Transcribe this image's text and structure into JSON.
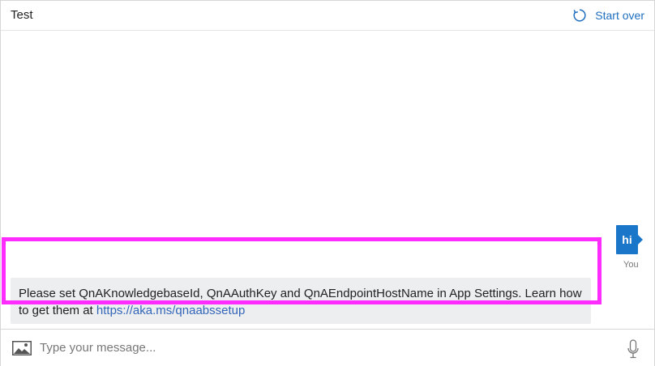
{
  "header": {
    "title": "Test",
    "start_over_label": "Start over",
    "start_over_icon": "refresh-icon"
  },
  "messages": {
    "user": {
      "text": "hi",
      "sender_label": "You"
    },
    "bot": {
      "text_before_link": "Please set QnAKnowledgebaseId, QnAAuthKey and QnAEndpointHostName in App Settings. Learn how to get them at ",
      "link_text": "https://aka.ms/qnaabssetup"
    }
  },
  "input": {
    "placeholder": "Type your message...",
    "value": "",
    "attach_icon": "image-icon",
    "mic_icon": "microphone-icon"
  },
  "colors": {
    "accent": "#1a76c8",
    "highlight": "#ff2cff",
    "bot_bubble_bg": "#eceef0",
    "link": "#3466b8"
  }
}
